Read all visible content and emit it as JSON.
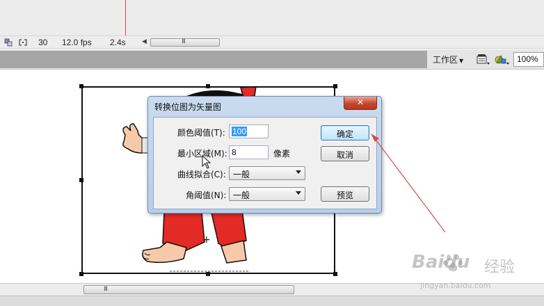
{
  "timeline": {
    "frame_number": "30",
    "frame_rate": "12.0 fps",
    "elapsed_time": "2.4s",
    "grip": "III"
  },
  "edit_bar": {
    "workspace_label": "工作区",
    "workspace_arrow": "▼",
    "zoom_value": "100%"
  },
  "dialog": {
    "title": "转换位图为矢量图",
    "close_glyph": "✕",
    "color_threshold_label": "颜色阈值(T):",
    "color_threshold_value": "100",
    "min_area_label": "最小区域(M):",
    "min_area_value": "8",
    "min_area_unit": "像素",
    "curve_fit_label": "曲线拟合(C):",
    "curve_fit_value": "一般",
    "corner_threshold_label": "角阈值(N):",
    "corner_threshold_value": "一般",
    "ok_label": "确定",
    "cancel_label": "取消",
    "preview_label": "预览"
  },
  "stage": {
    "scroll_grip": "III"
  },
  "watermark": {
    "brand": "Baidu",
    "suffix": "经验",
    "url": "jingyan.baidu.com"
  },
  "colors": {
    "annotation_arrow": "#d94a4a",
    "playhead": "#d64545",
    "dialog_frame": "#b8cfea",
    "default_button": "#bee6fd"
  }
}
